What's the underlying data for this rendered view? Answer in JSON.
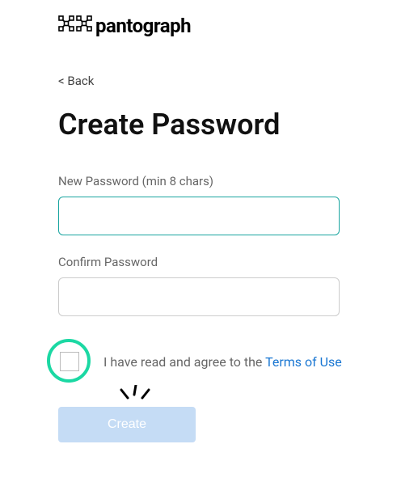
{
  "brand": {
    "name": "pantograph"
  },
  "nav": {
    "back_label": "< Back"
  },
  "title": "Create Password",
  "fields": {
    "new_password_label": "New Password (min 8 chars)",
    "new_password_value": "",
    "confirm_password_label": "Confirm Password",
    "confirm_password_value": ""
  },
  "terms": {
    "prefix": "I have read and agree to the ",
    "link_label": "Terms of Use"
  },
  "submit": {
    "label": "Create"
  }
}
